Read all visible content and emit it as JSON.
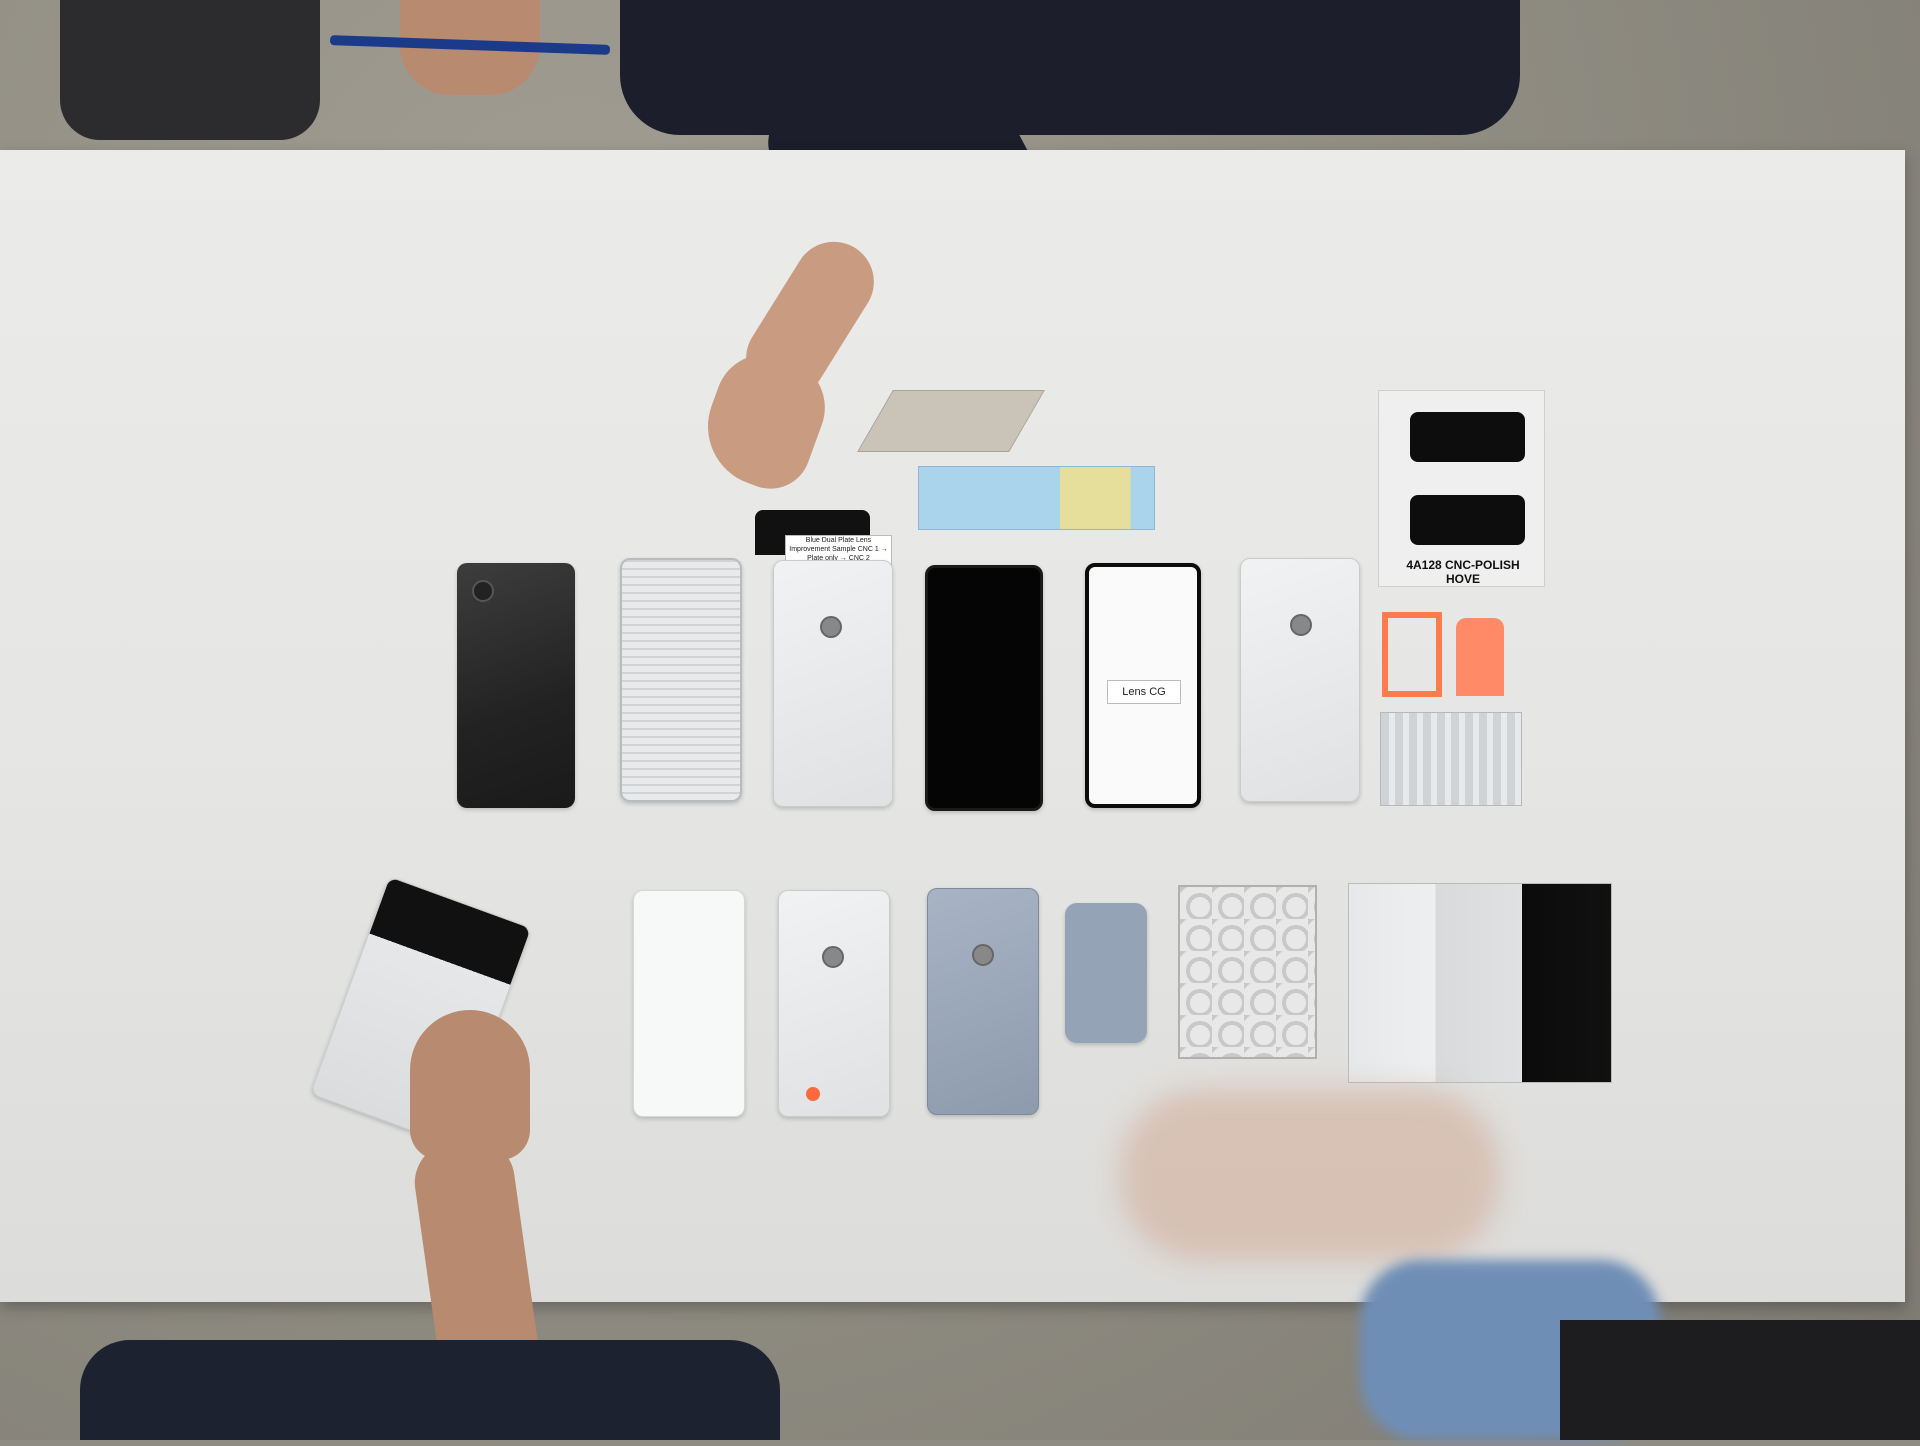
{
  "scene": {
    "type": "photo",
    "labels": {
      "lens_cg": "Lens CG",
      "handwritten_bag": "4A128 CNC-POLISH HOVE",
      "sticker_note": "Blue Dual Plate Lens Improvement Sample CNC 1 → Plate only → CNC 2"
    }
  }
}
